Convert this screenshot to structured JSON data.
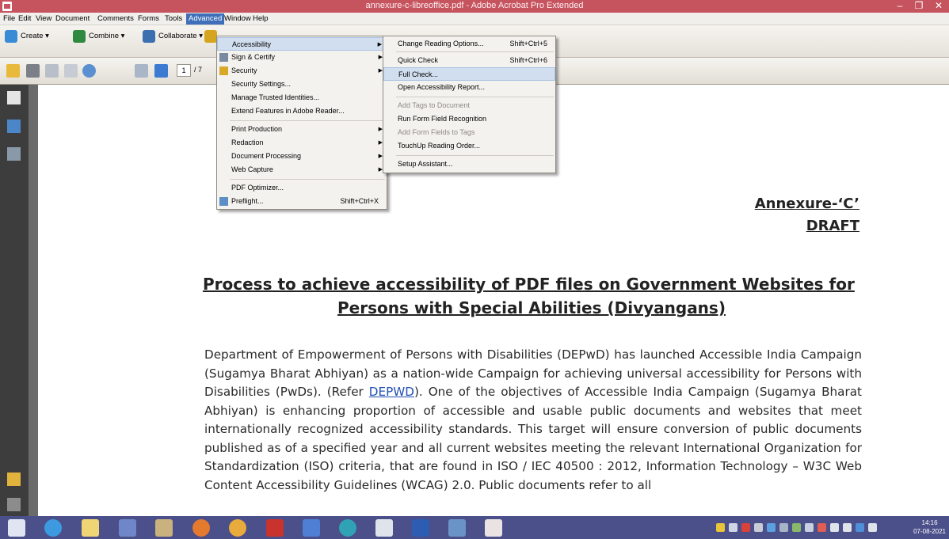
{
  "window": {
    "title": "annexure-c-libreoffice.pdf - Adobe Acrobat Pro Extended",
    "minimize": "–",
    "maximize": "❐",
    "close": "✕"
  },
  "menubar": [
    "File",
    "Edit",
    "View",
    "Document",
    "Comments",
    "Forms",
    "Tools",
    "Advanced",
    "Window",
    "Help"
  ],
  "toolbar": {
    "create": "Create ▾",
    "combine": "Combine ▾",
    "collaborate": "Collaborate ▾",
    "page_current": "1",
    "page_total": "/ 7"
  },
  "advanced_menu": {
    "items": [
      {
        "label": "Accessibility",
        "submenu": true,
        "highlighted": true
      },
      {
        "label": "Sign & Certify",
        "submenu": true
      },
      {
        "label": "Security",
        "submenu": true
      },
      {
        "label": "Security Settings..."
      },
      {
        "label": "Manage Trusted Identities..."
      },
      {
        "label": "Extend Features in Adobe Reader..."
      },
      {
        "label": "Print Production",
        "submenu": true
      },
      {
        "label": "Redaction",
        "submenu": true
      },
      {
        "label": "Document Processing",
        "submenu": true
      },
      {
        "label": "Web Capture",
        "submenu": true
      },
      {
        "label": "PDF Optimizer..."
      },
      {
        "label": "Preflight...",
        "shortcut": "Shift+Ctrl+X"
      }
    ]
  },
  "accessibility_menu": {
    "items": [
      {
        "label": "Change Reading Options...",
        "shortcut": "Shift+Ctrl+5"
      },
      {
        "label": "Quick Check",
        "shortcut": "Shift+Ctrl+6"
      },
      {
        "label": "Full Check...",
        "highlighted": true
      },
      {
        "label": "Open Accessibility Report..."
      },
      {
        "label": "Add Tags to Document",
        "disabled": true
      },
      {
        "label": "Run Form Field Recognition"
      },
      {
        "label": "Add Form Fields to Tags",
        "disabled": true
      },
      {
        "label": "TouchUp Reading Order..."
      },
      {
        "label": "Setup Assistant..."
      }
    ]
  },
  "document": {
    "annexure": "Annexure-‘C’",
    "draft": "DRAFT",
    "heading_line1": "Process to achieve accessibility of  PDF files on Government  Websites  for",
    "heading_line2": "Persons with Special Abilities (Divyangans)",
    "para_before_link": "Department of Empowerment of Persons with Disabilities (DEPwD) has launched Accessible India Campaign (Sugamya Bharat Abhiyan) as a nation-wide Campaign for achieving universal accessibility for Persons with Disabilities (PwDs). (Refer  ",
    "para_link": "DEPWD",
    "para_after_link": "). One of the objectives of Accessible India Campaign (Sugamya Bharat Abhiyan) is enhancing proportion of accessible and usable public documents and websites that meet internationally recognized accessibility standards. This target will ensure conversion of public documents published as of a specified year and all current websites meeting the relevant International Organization for Standardization (ISO) criteria, that are found in ISO / IEC 40500 : 2012, Information Technology – W3C Web Content Accessibility Guidelines (WCAG) 2.0. Public documents refer to all"
  },
  "clock": {
    "time": "14:16",
    "date": "07-08-2021"
  }
}
